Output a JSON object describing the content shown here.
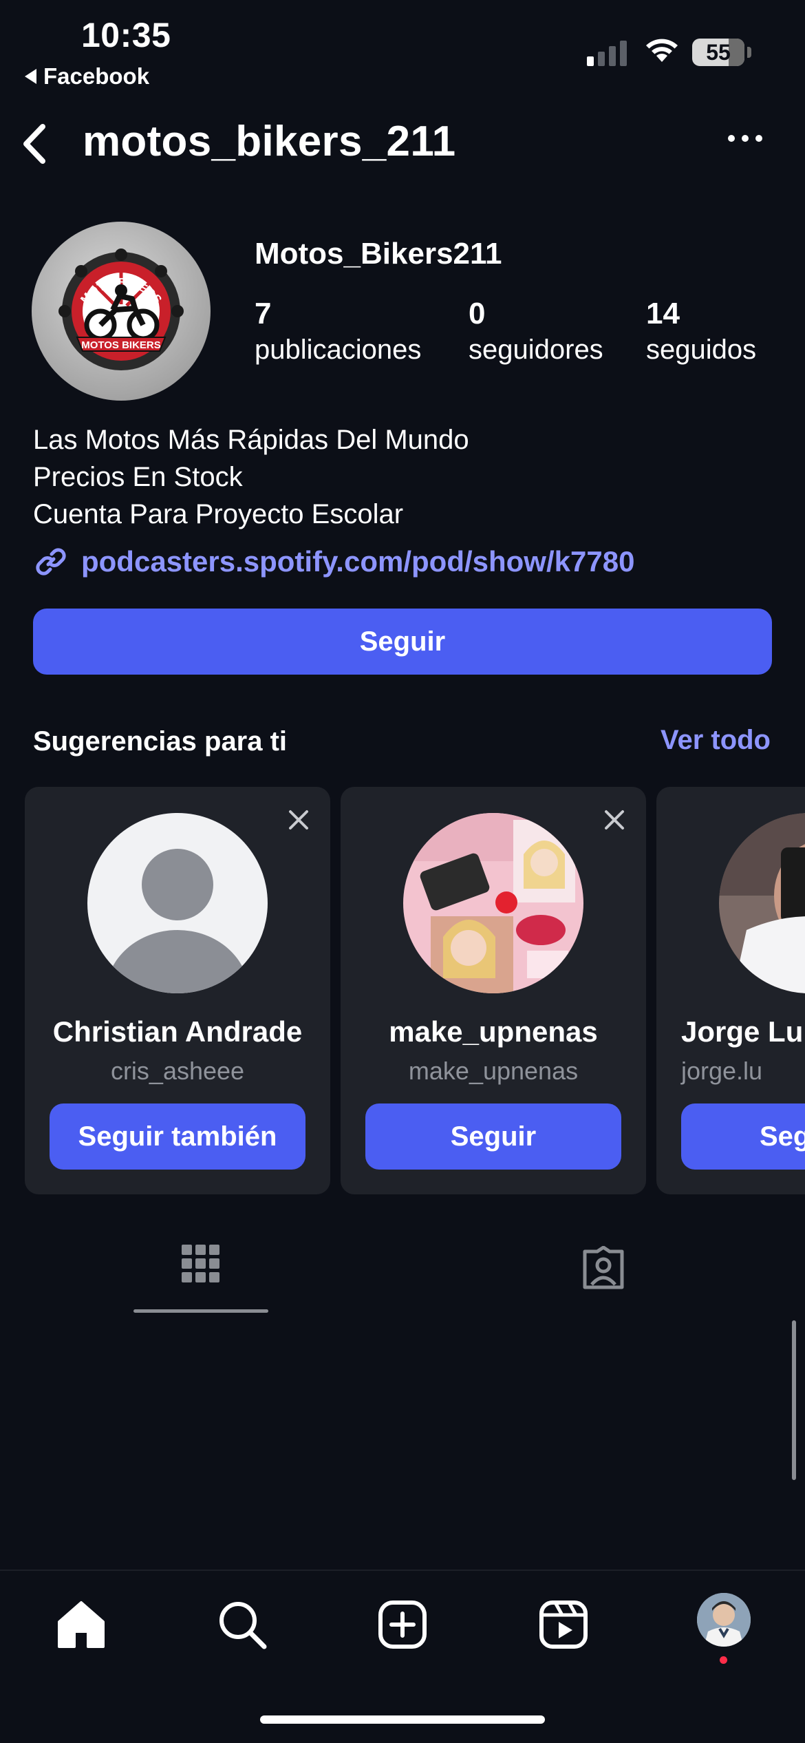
{
  "status_bar": {
    "time": "10:35",
    "back_app_label": "Facebook",
    "battery": "55"
  },
  "header": {
    "username": "motos_bikers_211"
  },
  "profile": {
    "display_name": "Motos_Bikers211",
    "stats": [
      {
        "value": "7",
        "label": "publicaciones"
      },
      {
        "value": "0",
        "label": "seguidores"
      },
      {
        "value": "14",
        "label": "seguidos"
      }
    ],
    "bio_lines": [
      "Las Motos Más Rápidas Del Mundo",
      "Precios En Stock",
      "Cuenta Para Proyecto Escolar"
    ],
    "link": "podcasters.spotify.com/pod/show/k7780",
    "follow_label": "Seguir",
    "avatar_logo_top": "MOTO BIKERS",
    "avatar_logo_bottom": "MOTOS BIKERS"
  },
  "suggestions": {
    "title": "Sugerencias para ti",
    "see_all": "Ver todo",
    "cards": [
      {
        "name": "Christian Andrade",
        "handle": "cris_asheee",
        "button": "Seguir también"
      },
      {
        "name": "make_upnenas",
        "handle": "make_upnenas",
        "button": "Seguir"
      },
      {
        "name": "Jorge Lu",
        "handle": "jorge.lu",
        "button": "Seg"
      }
    ]
  },
  "tabs": [
    {
      "icon": "grid-icon",
      "active": true
    },
    {
      "icon": "tagged-icon",
      "active": false
    }
  ],
  "bottom_nav": [
    {
      "icon": "home-icon"
    },
    {
      "icon": "search-icon"
    },
    {
      "icon": "create-icon"
    },
    {
      "icon": "reels-icon"
    },
    {
      "icon": "profile-avatar-icon"
    }
  ],
  "colors": {
    "background": "#0c0f17",
    "accent": "#4b5ef2",
    "link": "#8d95ff",
    "card": "#1f2229",
    "notification_dot": "#ff2d49"
  }
}
